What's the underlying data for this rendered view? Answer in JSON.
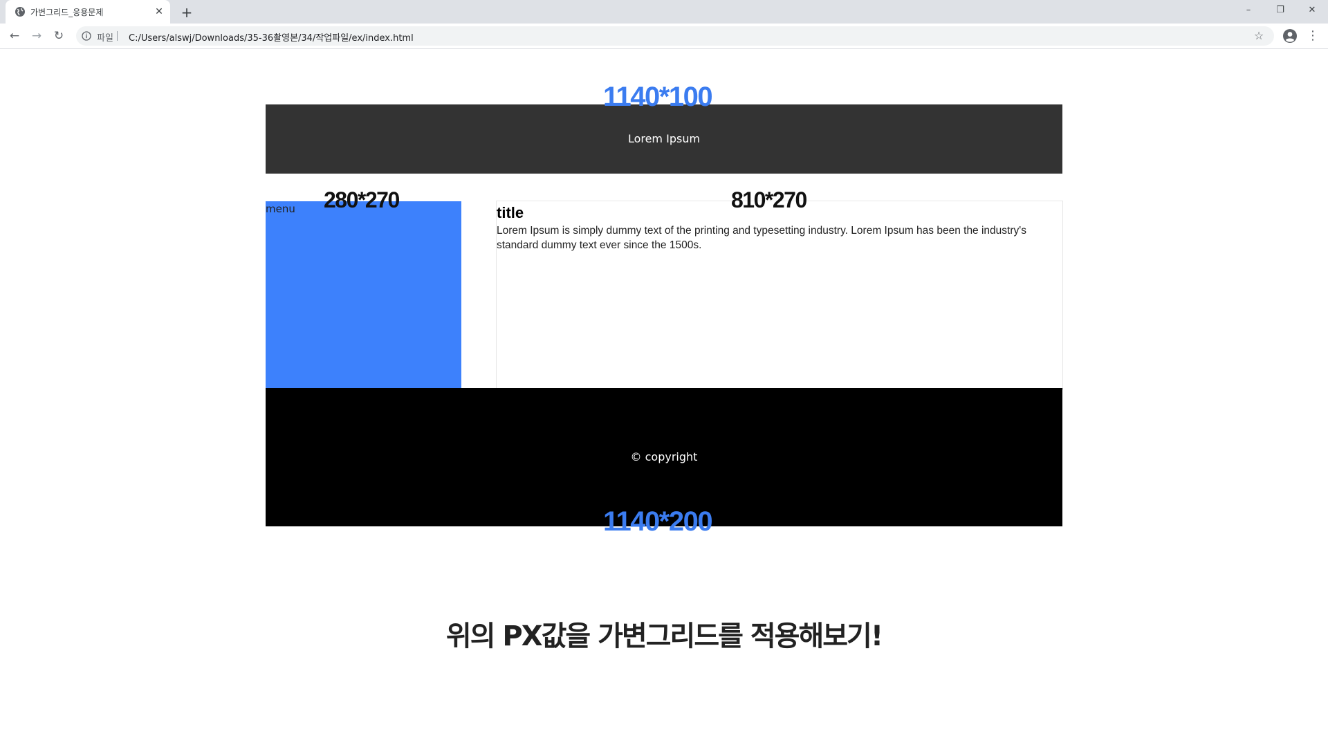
{
  "browser": {
    "tab_title": "가변그리드_응용문제",
    "new_tab_label": "+",
    "tab_close_label": "✕",
    "window_controls": {
      "minimize": "–",
      "restore": "❐",
      "close": "✕"
    },
    "nav": {
      "back": "←",
      "forward": "→",
      "reload": "↻"
    },
    "omnibox": {
      "scheme_label": "파일",
      "url": "C:/Users/alswj/Downloads/35-36촬영본/34/작업파일/ex/index.html"
    },
    "icons": {
      "favicon": "globe-icon",
      "info": "info-icon",
      "star": "star-icon",
      "profile": "account-circle-icon",
      "menu": "more-vert-icon"
    },
    "star_glyph": "☆",
    "menu_glyph": "⋮"
  },
  "page": {
    "header": {
      "dimension_label": "1140*100",
      "text": "Lorem Ipsum",
      "background": "#333333"
    },
    "menu": {
      "dimension_label": "280*270",
      "text": "menu",
      "background": "#3d81fc"
    },
    "content": {
      "dimension_label": "810*270",
      "title": "title",
      "body": "Lorem Ipsum is simply dummy text of the printing and typesetting industry. Lorem Ipsum has been the industry's standard dummy text ever since the 1500s."
    },
    "footer": {
      "dimension_label": "1140*200",
      "text": "© copyright",
      "background": "#000000"
    },
    "bottom_heading": "위의 PX값을 가변그리드를 적용해보기!",
    "accent_color": "#3b7cf0"
  }
}
